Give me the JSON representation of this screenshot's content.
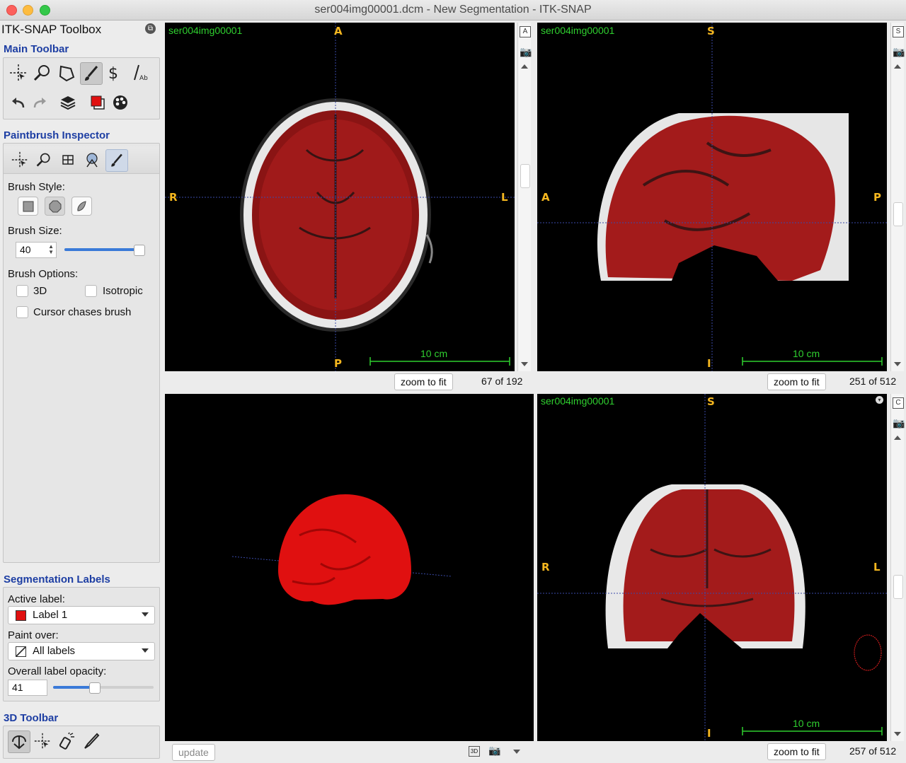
{
  "window": {
    "title": "ser004img00001.dcm - New Segmentation - ITK-SNAP"
  },
  "toolbox": {
    "title": "ITK-SNAP Toolbox",
    "main_toolbar": {
      "heading": "Main Toolbar",
      "tools": [
        "crosshair-icon",
        "zoom-icon",
        "polygon-icon",
        "paintbrush-icon",
        "snake-icon",
        "annotation-icon"
      ],
      "actions": [
        "undo-icon",
        "redo-icon",
        "layers-icon",
        "label-color-icon",
        "palette-icon"
      ]
    },
    "paintbrush": {
      "heading": "Paintbrush Inspector",
      "brush_style_label": "Brush Style:",
      "brush_size_label": "Brush Size:",
      "brush_size": "40",
      "brush_size_fraction": 0.95,
      "brush_options_label": "Brush Options:",
      "opt_3d": "3D",
      "opt_isotropic": "Isotropic",
      "opt_chase": "Cursor chases brush"
    },
    "labels": {
      "heading": "Segmentation Labels",
      "active_label_caption": "Active label:",
      "active_label": "Label 1",
      "active_label_color": "#e01010",
      "paint_over_caption": "Paint over:",
      "paint_over": "All labels",
      "opacity_caption": "Overall label opacity:",
      "opacity": "41",
      "opacity_fraction": 0.41
    },
    "toolbar3d": {
      "heading": "3D Toolbar"
    }
  },
  "views": {
    "axial": {
      "name": "ser004img00001",
      "top": "A",
      "bottom": "P",
      "left": "R",
      "right": "L",
      "scale": "10 cm",
      "zoom_btn": "zoom to fit",
      "slice": "67 of 192",
      "side_btn": "A"
    },
    "sagittal": {
      "name": "ser004img00001",
      "top": "S",
      "bottom": "I",
      "left": "A",
      "right": "P",
      "scale": "10 cm",
      "zoom_btn": "zoom to fit",
      "slice": "251 of 512",
      "side_btn": "S"
    },
    "coronal": {
      "name": "ser004img00001",
      "top": "S",
      "bottom": "I",
      "left": "R",
      "right": "L",
      "scale": "10 cm",
      "zoom_btn": "zoom to fit",
      "slice": "257 of 512",
      "side_btn": "C"
    },
    "render3d": {
      "update_btn": "update"
    }
  },
  "colors": {
    "accent_heading": "#1d3ea3",
    "overlay_label": "#2fcf2f",
    "orientation": "#f5b71f",
    "segmentation": "#b01818"
  }
}
